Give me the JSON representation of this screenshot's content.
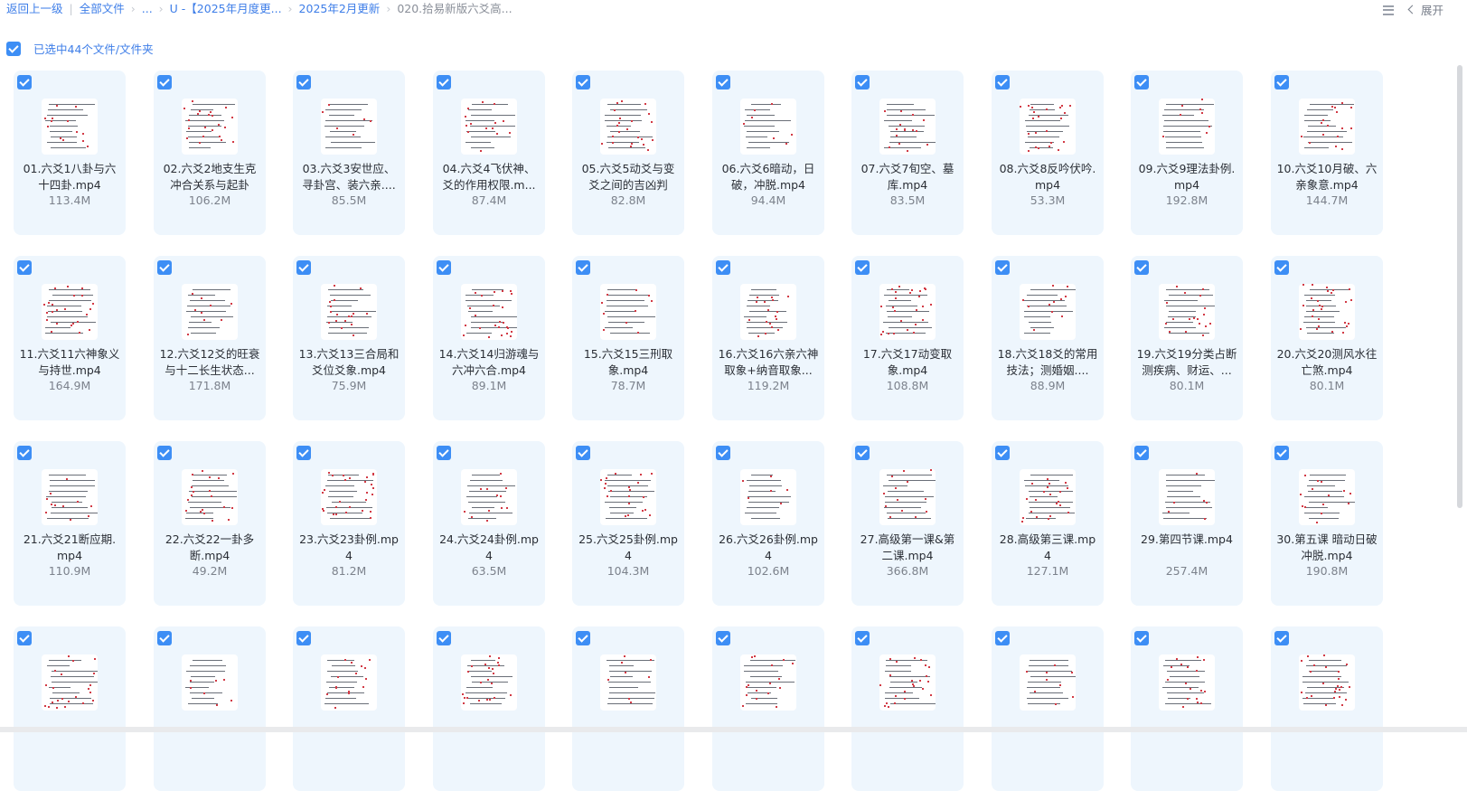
{
  "breadcrumb": {
    "back": "返回上一级",
    "all_files": "全部文件",
    "ellipsis": "...",
    "folder1": "U -【2025年月度更...",
    "folder2": "2025年2月更新",
    "current": "020.拾易新版六爻高..."
  },
  "toolbar": {
    "expand_label": "展开"
  },
  "selection": {
    "label": "已选中44个文件/文件夹"
  },
  "colors": {
    "accent": "#3d8ef5",
    "card_bg": "#eef6fd",
    "link": "#3e7ee8"
  },
  "files": [
    {
      "name": "01.六爻1八卦与六十四卦.mp4",
      "size": "113.4M"
    },
    {
      "name": "02.六爻2地支生克冲合关系与起卦",
      "size": "106.2M"
    },
    {
      "name": "03.六爻3安世应、寻卦宫、装六亲....",
      "size": "85.5M"
    },
    {
      "name": "04.六爻4飞伏神、爻的作用权限.m...",
      "size": "87.4M"
    },
    {
      "name": "05.六爻5动爻与变爻之间的吉凶判",
      "size": "82.8M"
    },
    {
      "name": "06.六爻6暗动，日破，冲脱.mp4",
      "size": "94.4M"
    },
    {
      "name": "07.六爻7旬空、墓库.mp4",
      "size": "83.5M"
    },
    {
      "name": "08.六爻8反吟伏吟.mp4",
      "size": "53.3M"
    },
    {
      "name": "09.六爻9理法卦例.mp4",
      "size": "192.8M"
    },
    {
      "name": "10.六爻10月破、六亲象意.mp4",
      "size": "144.7M"
    },
    {
      "name": "11.六爻11六神象义与持世.mp4",
      "size": "164.9M"
    },
    {
      "name": "12.六爻12爻的旺衰与十二长生状态...",
      "size": "171.8M"
    },
    {
      "name": "13.六爻13三合局和爻位爻象.mp4",
      "size": "75.9M"
    },
    {
      "name": "14.六爻14归游魂与六冲六合.mp4",
      "size": "89.1M"
    },
    {
      "name": "15.六爻15三刑取象.mp4",
      "size": "78.7M"
    },
    {
      "name": "16.六爻16六亲六神取象+纳音取象...",
      "size": "119.2M"
    },
    {
      "name": "17.六爻17动变取象.mp4",
      "size": "108.8M"
    },
    {
      "name": "18.六爻18爻的常用技法；测婚姻....",
      "size": "88.9M"
    },
    {
      "name": "19.六爻19分类占断测疾病、财运、...",
      "size": "80.1M"
    },
    {
      "name": "20.六爻20测风水往亡煞.mp4",
      "size": "80.1M"
    },
    {
      "name": "21.六爻21断应期.mp4",
      "size": "110.9M"
    },
    {
      "name": "22.六爻22一卦多断.mp4",
      "size": "49.2M"
    },
    {
      "name": "23.六爻23卦例.mp4",
      "size": "81.2M"
    },
    {
      "name": "24.六爻24卦例.mp4",
      "size": "63.5M"
    },
    {
      "name": "25.六爻25卦例.mp4",
      "size": "104.3M"
    },
    {
      "name": "26.六爻26卦例.mp4",
      "size": "102.6M"
    },
    {
      "name": "27.高级第一课&第二课.mp4",
      "size": "366.8M"
    },
    {
      "name": "28.高级第三课.mp4",
      "size": "127.1M"
    },
    {
      "name": "29.第四节课.mp4",
      "size": "257.4M"
    },
    {
      "name": "30.第五课 暗动日破冲脱.mp4",
      "size": "190.8M"
    },
    {
      "name": "",
      "size": ""
    },
    {
      "name": "",
      "size": ""
    },
    {
      "name": "",
      "size": ""
    },
    {
      "name": "",
      "size": ""
    },
    {
      "name": "",
      "size": ""
    },
    {
      "name": "",
      "size": ""
    },
    {
      "name": "",
      "size": ""
    },
    {
      "name": "",
      "size": ""
    },
    {
      "name": "",
      "size": ""
    },
    {
      "name": "",
      "size": ""
    }
  ]
}
